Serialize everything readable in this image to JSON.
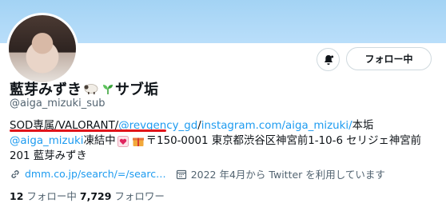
{
  "profile": {
    "display_name": "藍芽みずき",
    "name_suffix": "サブ垢",
    "handle": "@aiga_mizuki_sub",
    "follow_button": "フォロー中"
  },
  "bio": {
    "line1": {
      "prefix": "SOD専属/VALORANT/",
      "mention": "@revgency_gd",
      "sep": "/ ",
      "url": "instagram.com/aiga_mizuki/",
      "suffix": " 本垢"
    },
    "line2": {
      "mention": "@aiga_mizuki",
      "text1": "凍結中",
      "text2": "〒150-0001 東京都渋谷区神宮前1-10-6 セリジェ神宮前"
    },
    "line3": "201 藍芽みずき"
  },
  "meta": {
    "link": "dmm.co.jp/search/=/searc…",
    "joined": "2022 年4月から Twitter を利用しています"
  },
  "stats": {
    "following_count": "12",
    "following_label": "フォロー中",
    "followers_count": "7,729",
    "followers_label": "フォロワー"
  },
  "colors": {
    "banner": "#a3d3f4",
    "link": "#1d9bf0",
    "underline": "#e0141b"
  },
  "icons": [
    "notification-bell-icon",
    "sheep-icon",
    "seedling-icon",
    "heart-icon",
    "gift-icon",
    "link-icon",
    "calendar-icon"
  ]
}
